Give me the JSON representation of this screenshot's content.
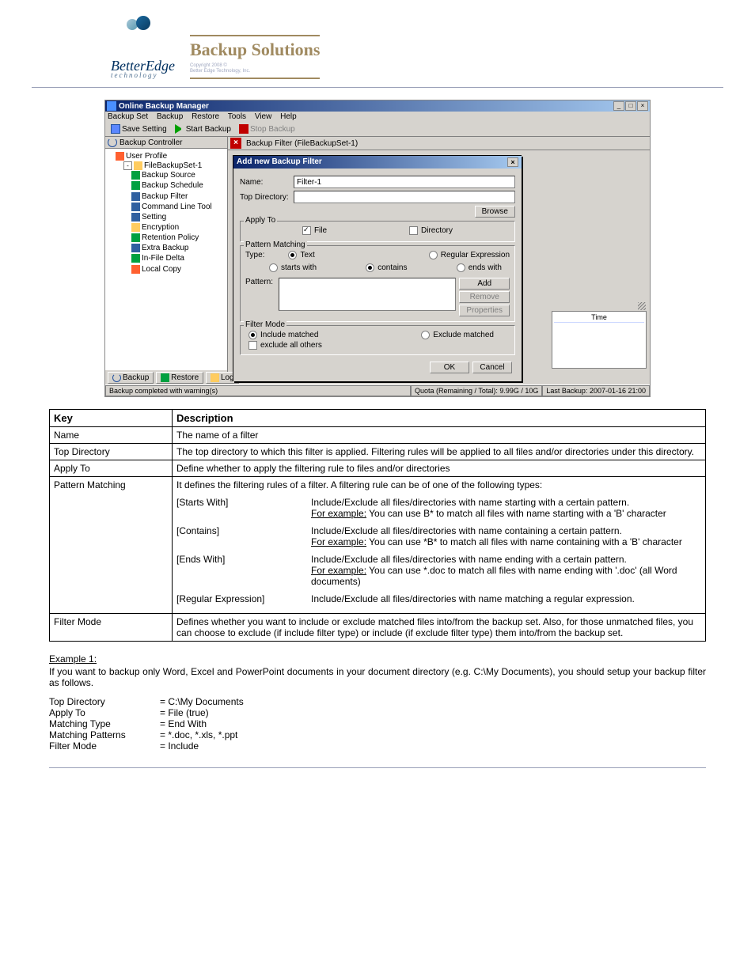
{
  "brand": {
    "logo_text": "BetterEdge",
    "logo_sub": "technology",
    "title": "Backup Solutions",
    "copyright": "Copyright 2008 ©\nBetter Edge Technology, Inc."
  },
  "window": {
    "title": "Online Backup Manager",
    "menu": [
      "Backup Set",
      "Backup",
      "Restore",
      "Tools",
      "View",
      "Help"
    ],
    "toolbar": {
      "save": "Save Setting",
      "start": "Start Backup",
      "stop": "Stop Backup"
    },
    "left": {
      "title": "Backup Controller",
      "tree": {
        "root": "User Profile",
        "set": "FileBackupSet-1",
        "items": [
          "Backup Source",
          "Backup Schedule",
          "Backup Filter",
          "Command Line Tool",
          "Setting",
          "Encryption",
          "Retention Policy",
          "Extra Backup",
          "In-File Delta",
          "Local Copy"
        ]
      }
    },
    "right": {
      "title": "Backup Filter (FileBackupSet-1)",
      "time_label": "Time"
    },
    "tabs": {
      "backup": "Backup",
      "restore": "Restore",
      "log": "Log"
    },
    "status": {
      "msg": "Backup completed with warning(s)",
      "quota": "Quota (Remaining / Total): 9.99G / 10G",
      "last": "Last Backup: 2007-01-16 21:00"
    }
  },
  "dialog": {
    "title": "Add new Backup Filter",
    "name_label": "Name:",
    "name_value": "Filter-1",
    "topdir_label": "Top Directory:",
    "topdir_value": "",
    "browse": "Browse",
    "apply_to": {
      "legend": "Apply To",
      "file": "File",
      "dir": "Directory",
      "file_checked": true,
      "dir_checked": false
    },
    "pattern": {
      "legend": "Pattern Matching",
      "type_label": "Type:",
      "text": "Text",
      "regex": "Regular Expression",
      "type_selected": "text",
      "starts": "starts with",
      "contains": "contains",
      "ends": "ends with",
      "match_selected": "contains",
      "pattern_label": "Pattern:",
      "add": "Add",
      "remove": "Remove",
      "properties": "Properties"
    },
    "mode": {
      "legend": "Filter Mode",
      "include": "Include matched",
      "exclude": "Exclude matched",
      "selected": "include",
      "exclude_others": "exclude all others",
      "exclude_others_checked": false
    },
    "ok": "OK",
    "cancel": "Cancel"
  },
  "table": {
    "col1": "Key",
    "col2": "Description",
    "rows": {
      "name": {
        "k": "Name",
        "d": "The name of a filter"
      },
      "topdir": {
        "k": "Top Directory",
        "d": "The top directory to which this filter is applied. Filtering rules will be applied to all files and/or directories under this directory."
      },
      "apply": {
        "k": "Apply To",
        "d": "Define whether to apply the filtering rule to files and/or directories"
      },
      "match": {
        "k": "Pattern Matching",
        "intro": "It defines the filtering rules of a filter. A filtering rule can be of one of the following types:",
        "starts": {
          "k": "[Starts With]",
          "d1": "Include/Exclude all files/directories with name starting with a certain pattern.",
          "d2": "For example:",
          "d3": " You can use B* to match all files with name starting with a 'B' character"
        },
        "contains": {
          "k": "[Contains]",
          "d1": "Include/Exclude all files/directories with name containing a certain pattern.",
          "d2": "For example:",
          "d3": " You can use *B* to match all files with name containing with a 'B' character"
        },
        "ends": {
          "k": "[Ends With]",
          "d1": "Include/Exclude all files/directories with name ending with a certain pattern.",
          "d2": "For example:",
          "d3": " You can use *.doc to match all files with name ending with '.doc' (all Word documents)"
        },
        "regex": {
          "k": "[Regular Expression]",
          "d1": "Include/Exclude all files/directories with name matching a regular expression."
        }
      },
      "mode": {
        "k": "Filter Mode",
        "d": "Defines whether you want to include or exclude matched files into/from the backup set. Also, for those unmatched files, you can choose to exclude (if include filter type) or include (if exclude filter type) them into/from the backup set."
      }
    }
  },
  "example": {
    "title": "Example 1:",
    "text": "If you want to backup only Word, Excel and PowerPoint documents in your document directory (e.g. C:\\My Documents), you should setup your backup filter as follows.",
    "settings": {
      "topdir": {
        "k": "Top Directory",
        "v": "= C:\\My Documents"
      },
      "apply": {
        "k": "Apply To",
        "v": "= File (true)"
      },
      "type": {
        "k": "Matching Type",
        "v": "= End With"
      },
      "patterns": {
        "k": "Matching Patterns",
        "v": "= *.doc, *.xls, *.ppt"
      },
      "mode": {
        "k": "Filter Mode",
        "v": "= Include"
      }
    }
  }
}
